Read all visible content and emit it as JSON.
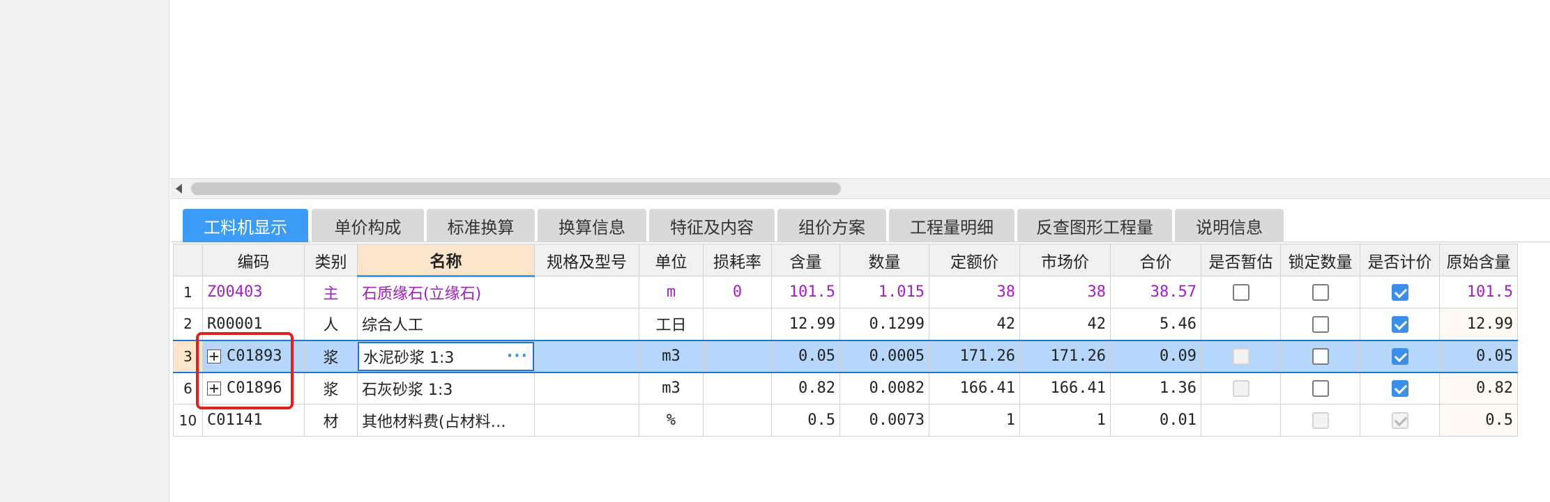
{
  "tabs": [
    "工料机显示",
    "单价构成",
    "标准换算",
    "换算信息",
    "特征及内容",
    "组价方案",
    "工程量明细",
    "反查图形工程量",
    "说明信息"
  ],
  "columns": [
    "编码",
    "类别",
    "名称",
    "规格及型号",
    "单位",
    "损耗率",
    "含量",
    "数量",
    "定额价",
    "市场价",
    "合价",
    "是否暂估",
    "锁定数量",
    "是否计价",
    "原始含量"
  ],
  "rows": [
    {
      "num": "1",
      "code": "Z00403",
      "type": "主",
      "name": "石质缘石(立缘石)",
      "spec": "",
      "unit": "m",
      "loss": "0",
      "content": "101.5",
      "qty": "1.015",
      "quota": "38",
      "market": "38",
      "total": "38.57",
      "orig": "101.5"
    },
    {
      "num": "2",
      "code": "R00001",
      "type": "人",
      "name": "综合人工",
      "spec": "",
      "unit": "工日",
      "loss": "",
      "content": "12.99",
      "qty": "0.1299",
      "quota": "42",
      "market": "42",
      "total": "5.46",
      "orig": "12.99"
    },
    {
      "num": "3",
      "code": "C01893",
      "type": "浆",
      "name": "水泥砂浆 1:3",
      "spec": "",
      "unit": "m3",
      "loss": "",
      "content": "0.05",
      "qty": "0.0005",
      "quota": "171.26",
      "market": "171.26",
      "total": "0.09",
      "orig": "0.05"
    },
    {
      "num": "6",
      "code": "C01896",
      "type": "浆",
      "name": "石灰砂浆 1:3",
      "spec": "",
      "unit": "m3",
      "loss": "",
      "content": "0.82",
      "qty": "0.0082",
      "quota": "166.41",
      "market": "166.41",
      "total": "1.36",
      "orig": "0.82"
    },
    {
      "num": "10",
      "code": "C01141",
      "type": "材",
      "name": "其他材料费(占材料…",
      "spec": "",
      "unit": "%",
      "loss": "",
      "content": "0.5",
      "qty": "0.0073",
      "quota": "1",
      "market": "1",
      "total": "0.01",
      "orig": "0.5"
    }
  ],
  "name_edit_button": "···",
  "colors": {
    "accent": "#3c9cf5",
    "selected_row": "#b6d6fa",
    "main_material_text": "#a020c0",
    "highlight_box": "#e02020"
  }
}
